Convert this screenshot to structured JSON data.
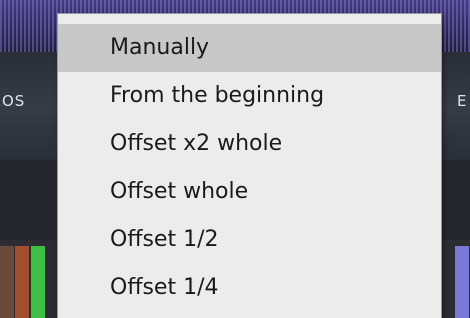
{
  "background": {
    "left_label": "OS",
    "right_label": "E"
  },
  "menu": {
    "highlighted_index": 0,
    "items": [
      {
        "label": "Manually"
      },
      {
        "label": "From the beginning"
      },
      {
        "label": "Offset x2 whole"
      },
      {
        "label": "Offset whole"
      },
      {
        "label": "Offset 1/2"
      },
      {
        "label": "Offset 1/4"
      }
    ]
  },
  "colors": {
    "menu_bg": "#ececec",
    "highlight": "#c8c8c8",
    "text": "#1a1a1a"
  }
}
